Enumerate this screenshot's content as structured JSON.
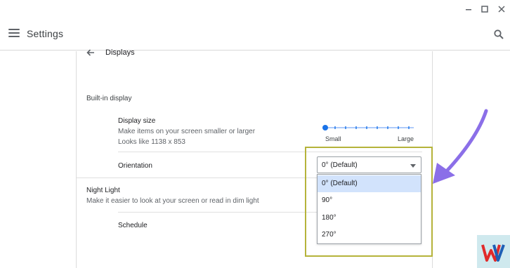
{
  "window_controls": {
    "minimize_icon": "minimize-icon",
    "maximize_icon": "maximize-icon",
    "close_icon": "close-icon"
  },
  "header": {
    "title": "Settings",
    "menu_icon": "hamburger-menu-icon",
    "search_icon": "search-icon"
  },
  "page": {
    "back_icon": "arrow-back-icon",
    "title": "Displays"
  },
  "built_in_display": {
    "section_title": "Built-in display",
    "display_size": {
      "title": "Display size",
      "description": "Make items on your screen smaller or larger",
      "looks_like": "Looks like 1138 x 853",
      "slider_min_label": "Small",
      "slider_max_label": "Large",
      "slider_level": 0
    },
    "orientation": {
      "label": "Orientation",
      "selected": "0° (Default)",
      "options": [
        "0° (Default)",
        "90°",
        "180°",
        "270°"
      ],
      "selected_index": 0
    }
  },
  "night_light": {
    "title": "Night Light",
    "description": "Make it easier to look at your screen or read in dim light",
    "schedule_label": "Schedule"
  },
  "colors": {
    "accent": "#1a73e8",
    "annotation_box": "#b5b33a",
    "annotation_arrow": "#8b6fe8",
    "selected_option_bg": "#d2e3fc"
  }
}
